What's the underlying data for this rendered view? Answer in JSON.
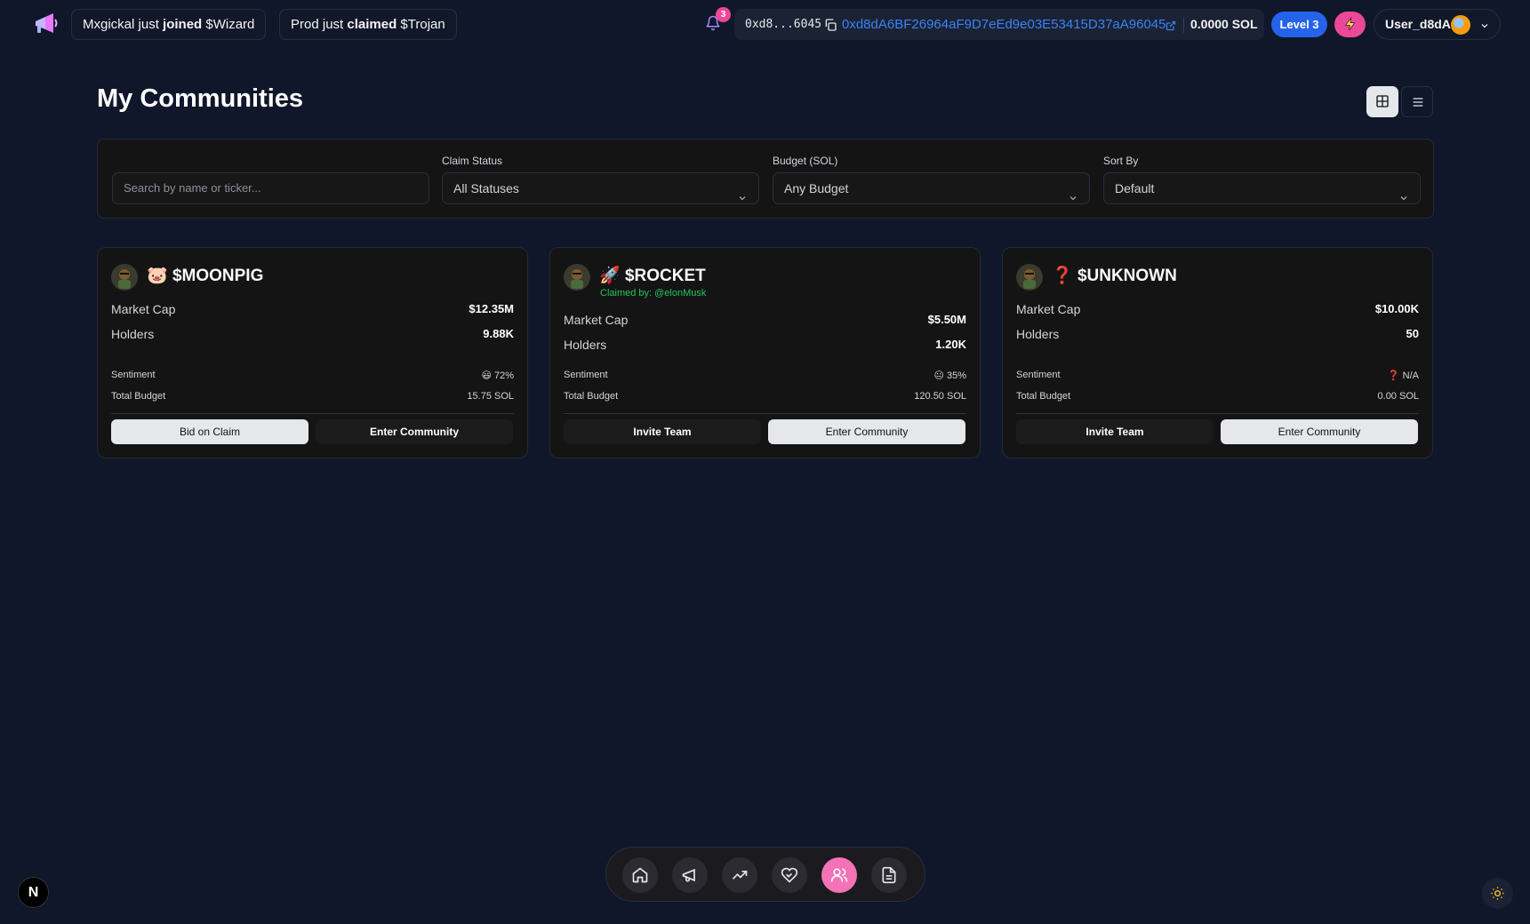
{
  "topbar": {
    "logo_icon": "megaphone-icon",
    "activity": [
      {
        "user": "Mxgickal",
        "middle": " just ",
        "action": "joined",
        "target": " $Wizard"
      },
      {
        "user": "Prod",
        "middle": " just ",
        "action": "claimed",
        "target": " $Trojan"
      }
    ],
    "notifications_count": "3",
    "wallet_short": "0xd8...6045",
    "wallet_full": "0xd8dA6BF26964aF9D7eEd9e03E53415D37aA96045",
    "balance": "0.0000 SOL",
    "level": "Level 3",
    "username": "User_d8dA"
  },
  "page": {
    "title": "My Communities"
  },
  "filters": {
    "search_placeholder": "Search by name or ticker...",
    "claim_status_label": "Claim Status",
    "claim_status_value": "All Statuses",
    "budget_label": "Budget (SOL)",
    "budget_value": "Any Budget",
    "sort_label": "Sort By",
    "sort_value": "Default"
  },
  "cards": [
    {
      "emoji": "🐷",
      "name": "$MOONPIG",
      "claimed_by": "",
      "market_cap_label": "Market Cap",
      "market_cap": "$12.35M",
      "holders_label": "Holders",
      "holders": "9.88K",
      "sentiment_label": "Sentiment",
      "sentiment": "😃 72%",
      "budget_label": "Total Budget",
      "budget": "15.75 SOL",
      "btn_left": "Bid on Claim",
      "btn_right": "Enter Community"
    },
    {
      "emoji": "🚀",
      "name": "$ROCKET",
      "claimed_by": "Claimed by: @elonMusk",
      "market_cap_label": "Market Cap",
      "market_cap": "$5.50M",
      "holders_label": "Holders",
      "holders": "1.20K",
      "sentiment_label": "Sentiment",
      "sentiment": "😐 35%",
      "budget_label": "Total Budget",
      "budget": "120.50 SOL",
      "btn_left": "Invite Team",
      "btn_right": "Enter Community"
    },
    {
      "emoji": "❓",
      "name": "$UNKNOWN",
      "claimed_by": "",
      "market_cap_label": "Market Cap",
      "market_cap": "$10.00K",
      "holders_label": "Holders",
      "holders": "50",
      "sentiment_label": "Sentiment",
      "sentiment": "❓ N/A",
      "budget_label": "Total Budget",
      "budget": "0.00 SOL",
      "btn_left": "Invite Team",
      "btn_right": "Enter Community"
    }
  ],
  "bottom_nav": {
    "items": [
      "home-icon",
      "megaphone-icon",
      "trending-icon",
      "handshake-heart-icon",
      "users-icon",
      "document-icon"
    ],
    "active": "users-icon"
  },
  "misc": {
    "badge_letter": "N",
    "accent_pink": "#ec4899",
    "accent_blue": "#2563eb",
    "claimed_green": "#22c55e"
  }
}
